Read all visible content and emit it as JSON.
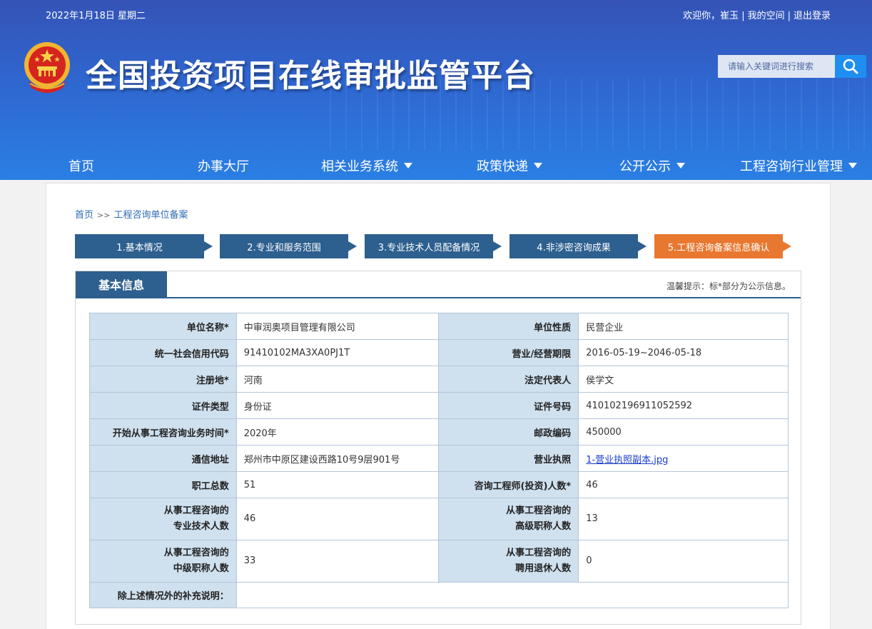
{
  "header": {
    "date": "2022年1月18日 星期二",
    "welcome": "欢迎你，崔玉",
    "my_space": "我的空间",
    "logout": "退出登录",
    "title": "全国投资项目在线审批监管平台",
    "search_placeholder": "请输入关键词进行搜索",
    "colors": {
      "gradient_top": "#3553b6",
      "gradient_bottom": "#2a7fe4",
      "search_button": "#1f8ef1"
    }
  },
  "nav": {
    "items": [
      {
        "label": "首页",
        "has_dropdown": false
      },
      {
        "label": "办事大厅",
        "has_dropdown": false
      },
      {
        "label": "相关业务系统",
        "has_dropdown": true
      },
      {
        "label": "政策快递",
        "has_dropdown": true
      },
      {
        "label": "公开公示",
        "has_dropdown": true
      },
      {
        "label": "工程咨询行业管理",
        "has_dropdown": true
      }
    ]
  },
  "breadcrumb": {
    "home": "首页",
    "separator": ">>",
    "current": "工程咨询单位备案"
  },
  "steps": [
    {
      "label": "1.基本情况",
      "active": false
    },
    {
      "label": "2.专业和服务范围",
      "active": false
    },
    {
      "label": "3.专业技术人员配备情况",
      "active": false
    },
    {
      "label": "4.非涉密咨询成果",
      "active": false
    },
    {
      "label": "5.工程咨询备案信息确认",
      "active": true
    }
  ],
  "colors": {
    "step_blue": "#2d5f8f",
    "step_active": "#e8772f",
    "label_cell": "#cfe0ee"
  },
  "section": {
    "title": "基本信息",
    "tip": "温馨提示：标*部分为公示信息。"
  },
  "table": {
    "unit_name_label": "单位名称*",
    "unit_name": "中审润奥项目管理有限公司",
    "unit_nature_label": "单位性质",
    "unit_nature": "民营企业",
    "credit_code_label": "统一社会信用代码",
    "credit_code": "91410102MA3XA0PJ1T",
    "business_term_label": "营业/经营期限",
    "business_term": "2016-05-19~2046-05-18",
    "reg_place_label": "注册地*",
    "reg_place": "河南",
    "legal_rep_label": "法定代表人",
    "legal_rep": "侯学文",
    "cert_type_label": "证件类型",
    "cert_type": "身份证",
    "cert_no_label": "证件号码",
    "cert_no": "410102196911052592",
    "start_time_label": "开始从事工程咨询业务时间*",
    "start_time": "2020年",
    "postcode_label": "邮政编码",
    "postcode": "450000",
    "address_label": "通信地址",
    "address": "郑州市中原区建设西路10号9层901号",
    "license_label": "营业执照",
    "license": "1-营业执照副本.jpg",
    "staff_total_label": "职工总数",
    "staff_total": "51",
    "engineers_label": "咨询工程师(投资)人数*",
    "engineers": "46",
    "tech_staff_label_1": "从事工程咨询的",
    "tech_staff_label_2": "专业技术人数",
    "tech_staff": "46",
    "senior_label_1": "从事工程咨询的",
    "senior_label_2": "高级职称人数",
    "senior": "13",
    "mid_label_1": "从事工程咨询的",
    "mid_label_2": "中级职称人数",
    "mid": "33",
    "retired_label_1": "从事工程咨询的",
    "retired_label_2": "聘用退休人数",
    "retired": "0",
    "extra_label": "除上述情况外的补充说明：",
    "extra": ""
  }
}
